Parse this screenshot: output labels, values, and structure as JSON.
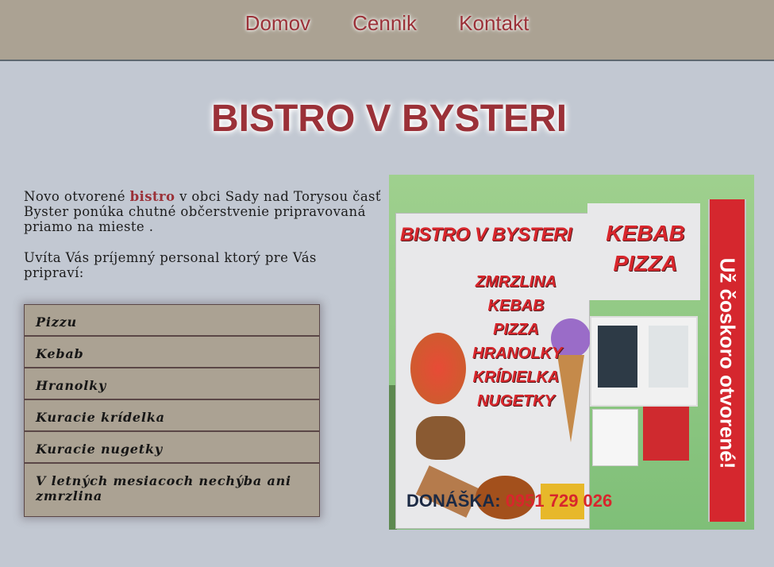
{
  "nav": {
    "items": [
      "Domov",
      "Cennik",
      "Kontakt"
    ]
  },
  "page": {
    "title": "BISTRO V BYSTERI"
  },
  "intro": {
    "p1_before": "Novo otvorené ",
    "p1_highlight": "bistro",
    "p1_after": " v obci Sady nad Torysou časť Byster ponúka chutné občerstvenie pripravovaná priamo na mieste .",
    "p2": "Uvíta Vás príjemný personal ktorý pre Vás pripraví:"
  },
  "menu": {
    "items": [
      "Pizzu",
      "Kebab",
      "Hranolky",
      "Kuracie krídelka",
      "Kuracie nugetky",
      "V letných mesiacoch nechýba ani zmrzlina"
    ]
  },
  "photo": {
    "banner_title": "BISTRO V BYSTERI",
    "kebab_pizza": [
      "KEBAB",
      "PIZZA"
    ],
    "food_list": [
      "ZMRZLINA",
      "KEBAB",
      "PIZZA",
      "HRANOLKY",
      "KRÍDIELKA",
      "NUGETKY"
    ],
    "delivery_label": "DONÁŠKA:",
    "delivery_number": "0951 729 026",
    "vertical_banner": "Už čoskoro otvorené!"
  },
  "colors": {
    "accent": "#9b3138",
    "header_bg": "#aba293",
    "page_bg": "#c2c8d2",
    "menu_bg": "#aba293"
  }
}
